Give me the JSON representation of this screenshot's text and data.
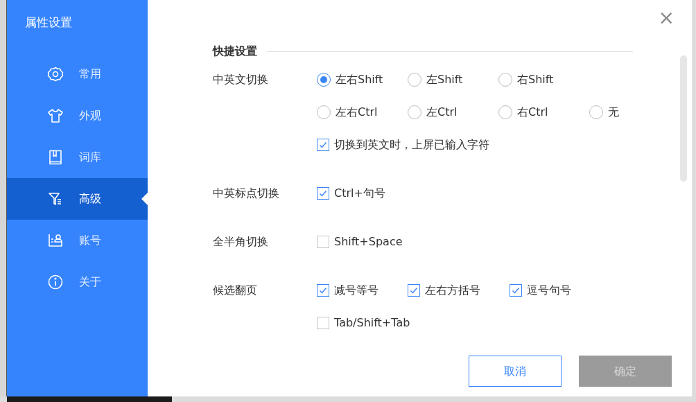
{
  "sidebar": {
    "title": "属性设置",
    "items": [
      {
        "label": "常用",
        "selected": false
      },
      {
        "label": "外观",
        "selected": false
      },
      {
        "label": "词库",
        "selected": false
      },
      {
        "label": "高级",
        "selected": true
      },
      {
        "label": "账号",
        "selected": false
      },
      {
        "label": "关于",
        "selected": false
      }
    ]
  },
  "close": "×",
  "section_title": "快捷设置",
  "settings": [
    {
      "label": "中英文切换",
      "rows": [
        [
          {
            "kind": "radio",
            "label": "左右Shift",
            "selected": true
          },
          {
            "kind": "radio",
            "label": "左Shift",
            "selected": false
          },
          {
            "kind": "radio",
            "label": "右Shift",
            "selected": false
          }
        ],
        [
          {
            "kind": "radio",
            "label": "左右Ctrl",
            "selected": false
          },
          {
            "kind": "radio",
            "label": "左Ctrl",
            "selected": false
          },
          {
            "kind": "radio",
            "label": "右Ctrl",
            "selected": false
          },
          {
            "kind": "radio",
            "label": "无",
            "selected": false
          }
        ],
        [
          {
            "kind": "checkbox",
            "label": "切换到英文时，上屏已输入字符",
            "checked": true
          }
        ]
      ]
    },
    {
      "label": "中英标点切换",
      "rows": [
        [
          {
            "kind": "checkbox",
            "label": "Ctrl+句号",
            "checked": true
          }
        ]
      ]
    },
    {
      "label": "全半角切换",
      "rows": [
        [
          {
            "kind": "checkbox",
            "label": "Shift+Space",
            "checked": false
          }
        ]
      ]
    },
    {
      "label": "候选翻页",
      "rows": [
        [
          {
            "kind": "checkbox",
            "label": "减号等号",
            "checked": true
          },
          {
            "kind": "checkbox",
            "label": "左右方括号",
            "checked": true
          },
          {
            "kind": "checkbox",
            "label": "逗号句号",
            "checked": true
          }
        ],
        [
          {
            "kind": "checkbox",
            "label": "Tab/Shift+Tab",
            "checked": false
          }
        ]
      ]
    }
  ],
  "buttons": [
    {
      "label": "取消",
      "kind": "secondary",
      "disabled": false
    },
    {
      "label": "确定",
      "kind": "primary",
      "disabled": true
    }
  ]
}
